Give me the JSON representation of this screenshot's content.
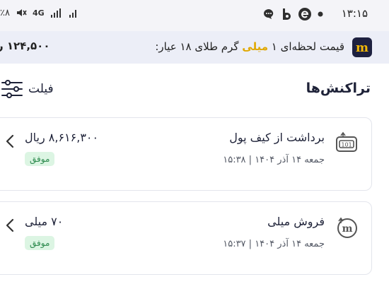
{
  "status_bar": {
    "time": "۱۳:۱۵",
    "network": "4G",
    "battery": "٪۸"
  },
  "ticker": {
    "caption_prefix": "قیمت لحظه‌ای ۱",
    "caption_highlight": "میلی",
    "caption_suffix": "گرم طلای ۱۸ عیار:",
    "price": "۱۲۴,۵۰۰ ر"
  },
  "section": {
    "title": "تراکنش‌ها",
    "filter_label": "فیلت"
  },
  "transactions": [
    {
      "title": "برداشت از کیف پول",
      "date": "جمعه ۱۴ آذر ۱۴۰۴ | ۱۵:۳۸",
      "amount": "۸,۶۱۶,۳۰۰ ریال",
      "status": "موفق",
      "icon": "wallet-withdraw-icon"
    },
    {
      "title": "فروش میلی",
      "date": "جمعه ۱۴ آذر ۱۴۰۴ | ۱۵:۳۷",
      "amount": "۷۰ میلی",
      "status": "موفق",
      "icon": "milli-sell-icon"
    }
  ],
  "colors": {
    "accent": "#e0a800",
    "success_bg": "#dcf5e3",
    "success_text": "#2e8b4f",
    "logo_bg": "#1e2140"
  }
}
